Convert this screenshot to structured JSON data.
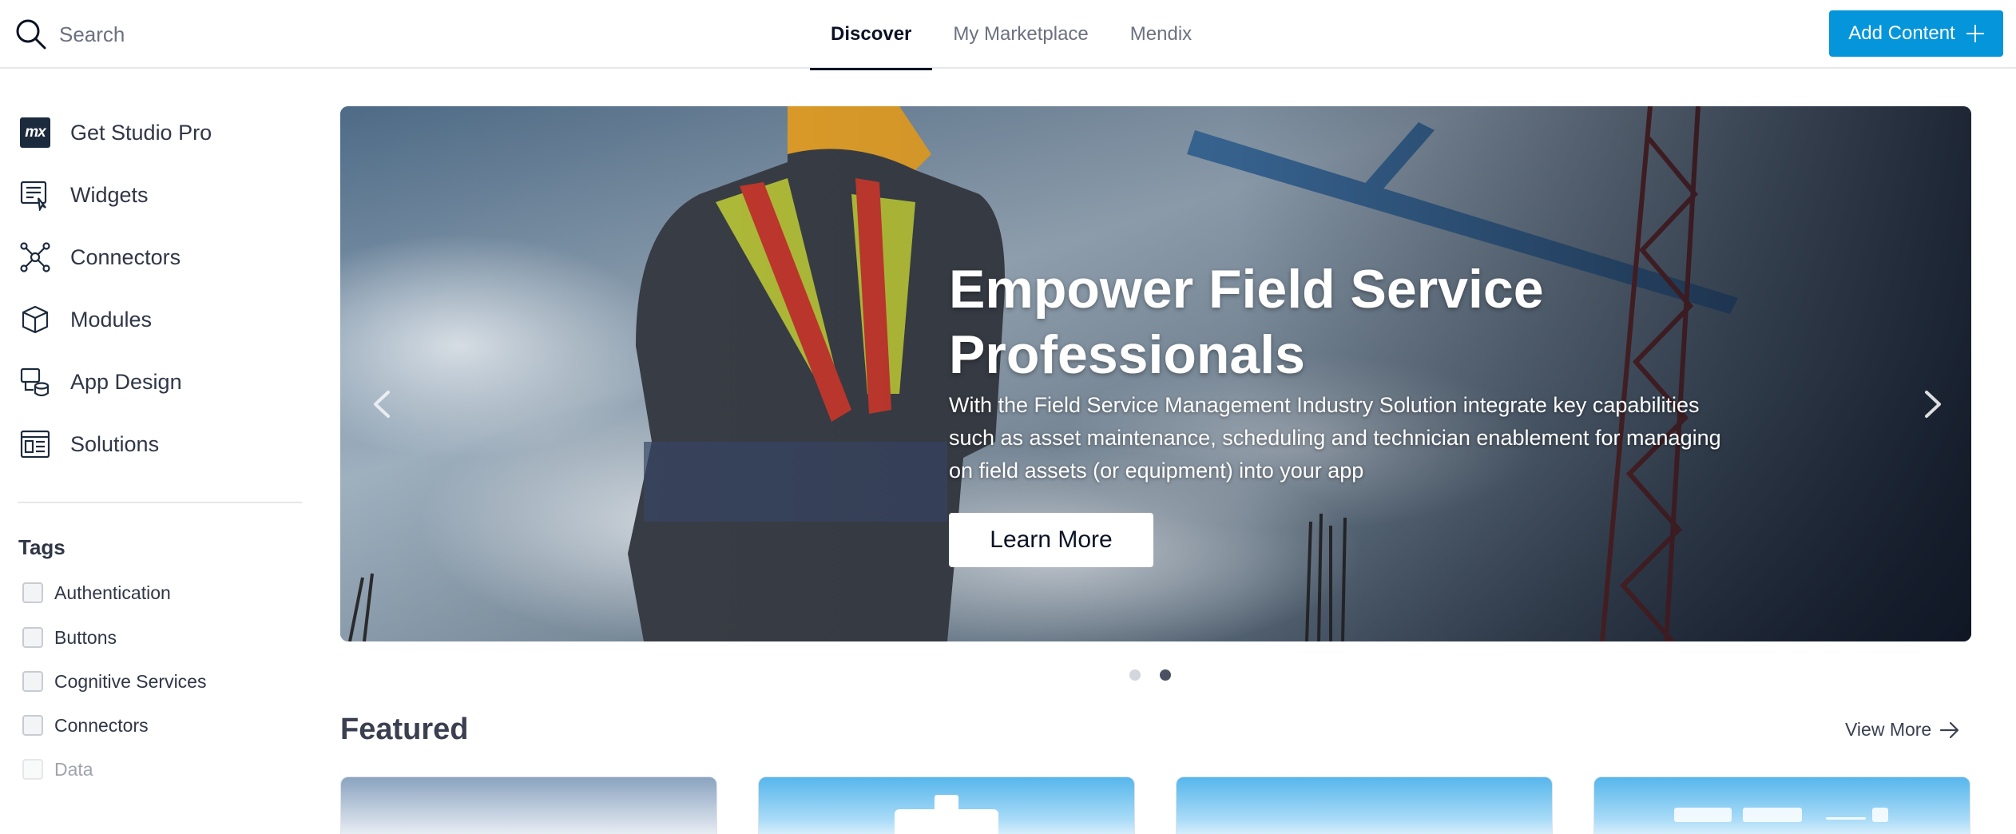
{
  "search": {
    "placeholder": "Search"
  },
  "tabs": [
    {
      "label": "Discover",
      "active": true
    },
    {
      "label": "My Marketplace",
      "active": false
    },
    {
      "label": "Mendix",
      "active": false
    }
  ],
  "add_content": {
    "label": "Add Content",
    "icon": "plus-icon"
  },
  "sidebar": {
    "items": [
      {
        "label": "Get Studio Pro",
        "icon": "mx-logo"
      },
      {
        "label": "Widgets",
        "icon": "widget-icon"
      },
      {
        "label": "Connectors",
        "icon": "connector-network-icon"
      },
      {
        "label": "Modules",
        "icon": "module-cube-icon"
      },
      {
        "label": "App Design",
        "icon": "app-design-icon"
      },
      {
        "label": "Solutions",
        "icon": "solutions-icon"
      }
    ],
    "mx_logo_text": "mx",
    "tags_title": "Tags",
    "tags": [
      {
        "label": "Authentication"
      },
      {
        "label": "Buttons"
      },
      {
        "label": "Cognitive Services"
      },
      {
        "label": "Connectors"
      },
      {
        "label": "Data"
      }
    ]
  },
  "hero": {
    "title": "Empower Field Service Professionals",
    "description": "With the Field Service Management Industry Solution integrate key capabilities such as asset maintenance, scheduling and technician enablement for managing on field assets (or equipment) into your app",
    "button": "Learn More",
    "slides": 2,
    "active_slide": 2
  },
  "featured": {
    "title": "Featured",
    "view_more": "View More"
  },
  "colors": {
    "accent": "#0595db",
    "text": "#0a1325",
    "muted": "#6c7180"
  }
}
